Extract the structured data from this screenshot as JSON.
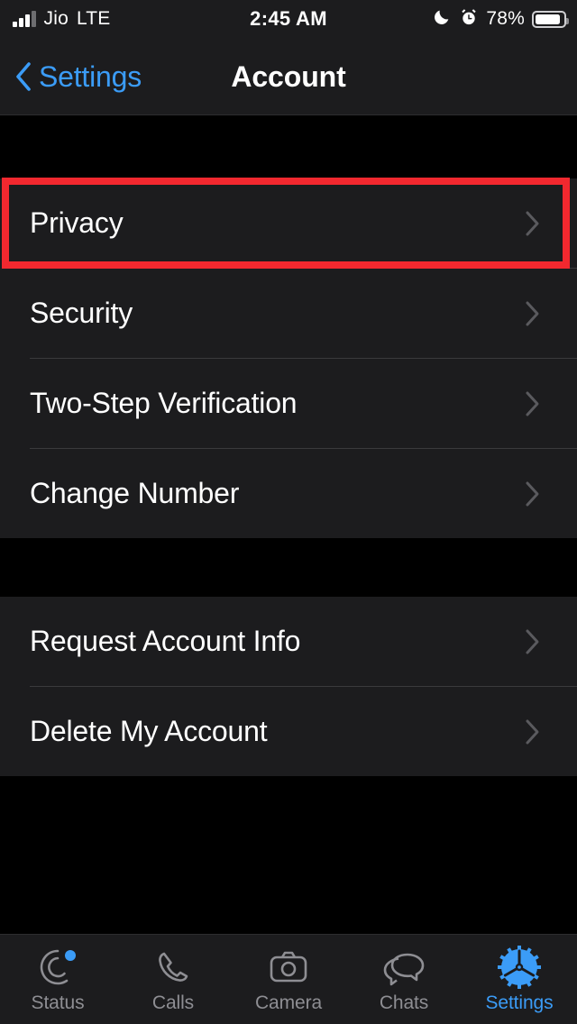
{
  "status_bar": {
    "carrier": "Jio",
    "network": "LTE",
    "time": "2:45 AM",
    "battery_percent": "78%",
    "icons": [
      "signal-bars-icon",
      "moon-icon",
      "alarm-icon",
      "battery-icon"
    ]
  },
  "nav_bar": {
    "back_label": "Settings",
    "back_icon": "chevron-left-icon",
    "title": "Account"
  },
  "colors": {
    "accent": "#3b9cf7",
    "highlight": "#f2282f",
    "row_background": "#1c1c1e",
    "page_background": "#000000",
    "separator": "#3a3a3c",
    "chevron": "#5a5a5e",
    "inactive_tab": "#8e8e93"
  },
  "groups": [
    {
      "rows": [
        {
          "label": "Privacy",
          "chevron": "chevron-right-icon",
          "highlighted": true
        },
        {
          "label": "Security",
          "chevron": "chevron-right-icon",
          "highlighted": false
        },
        {
          "label": "Two-Step Verification",
          "chevron": "chevron-right-icon",
          "highlighted": false
        },
        {
          "label": "Change Number",
          "chevron": "chevron-right-icon",
          "highlighted": false
        }
      ]
    },
    {
      "rows": [
        {
          "label": "Request Account Info",
          "chevron": "chevron-right-icon",
          "highlighted": false
        },
        {
          "label": "Delete My Account",
          "chevron": "chevron-right-icon",
          "highlighted": false
        }
      ]
    }
  ],
  "tab_bar": {
    "tabs": [
      {
        "label": "Status",
        "icon": "status-rings-icon",
        "active": false,
        "badge": true
      },
      {
        "label": "Calls",
        "icon": "phone-icon",
        "active": false,
        "badge": false
      },
      {
        "label": "Camera",
        "icon": "camera-icon",
        "active": false,
        "badge": false
      },
      {
        "label": "Chats",
        "icon": "chat-bubbles-icon",
        "active": false,
        "badge": false
      },
      {
        "label": "Settings",
        "icon": "gear-icon",
        "active": true,
        "badge": false
      }
    ]
  }
}
